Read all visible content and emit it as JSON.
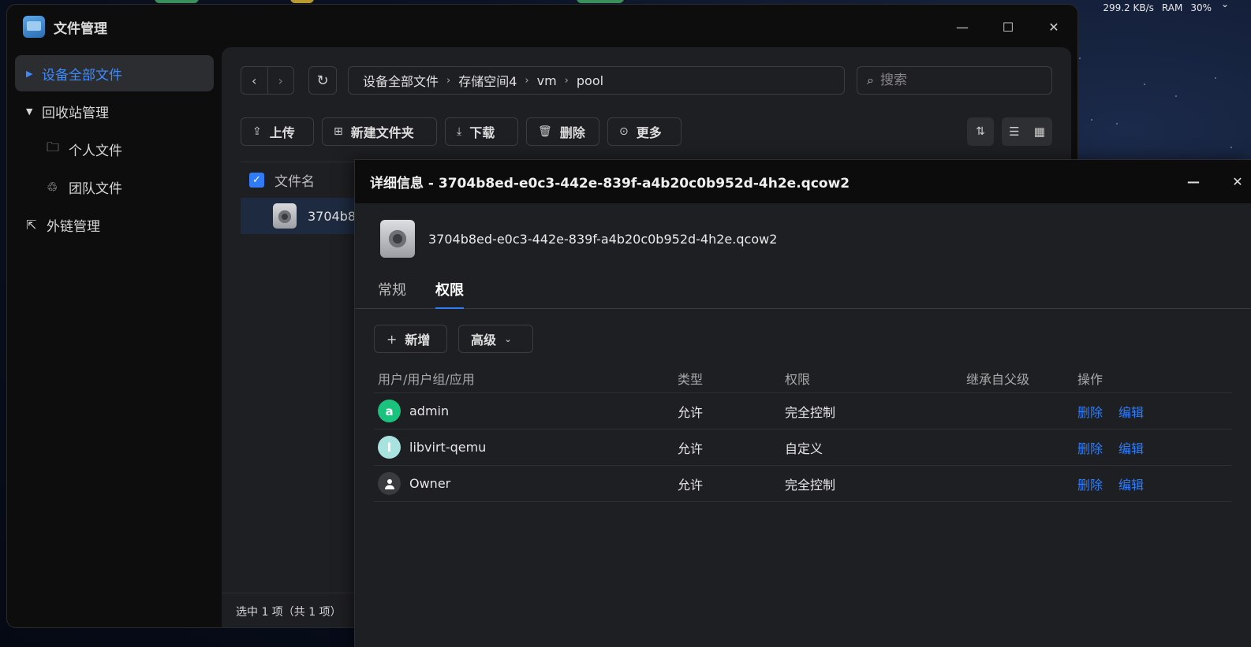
{
  "status_bar": {
    "net_speed": "299.2 KB/s",
    "ram_label": "RAM",
    "ram_value": "30%"
  },
  "app": {
    "title": "文件管理"
  },
  "sidebar": {
    "items": [
      {
        "label": "设备全部文件"
      },
      {
        "label": "回收站管理"
      },
      {
        "label": "个人文件"
      },
      {
        "label": "团队文件"
      },
      {
        "label": "外链管理"
      }
    ]
  },
  "breadcrumb": [
    "设备全部文件",
    "存储空间4",
    "vm",
    "pool"
  ],
  "search": {
    "placeholder": "搜索"
  },
  "toolbar": {
    "upload": "上传",
    "new_folder": "新建文件夹",
    "download": "下载",
    "delete": "删除",
    "more": "更多"
  },
  "file_list": {
    "header_name": "文件名",
    "rows": [
      {
        "name": "3704b8"
      }
    ]
  },
  "footer": {
    "selection": "选中 1 项（共 1 项）"
  },
  "details": {
    "title": "详细信息 - 3704b8ed-e0c3-442e-839f-a4b20c0b952d-4h2e.qcow2",
    "filename": "3704b8ed-e0c3-442e-839f-a4b20c0b952d-4h2e.qcow2",
    "tabs": [
      {
        "label": "常规"
      },
      {
        "label": "权限"
      }
    ],
    "add_button": "新增",
    "advanced_button": "高级",
    "columns": [
      "用户/用户组/应用",
      "类型",
      "权限",
      "继承自父级",
      "操作"
    ],
    "rows": [
      {
        "avatar": "a",
        "avatar_color": "#19c37d",
        "user": "admin",
        "type": "允许",
        "permission": "完全控制",
        "inherited": "",
        "delete": "删除",
        "edit": "编辑"
      },
      {
        "avatar": "l",
        "avatar_color": "#a9e3e0",
        "user": "libvirt-qemu",
        "type": "允许",
        "permission": "自定义",
        "inherited": "",
        "delete": "删除",
        "edit": "编辑"
      },
      {
        "avatar": "person-icon",
        "avatar_color": "#3a3b3f",
        "user": "Owner",
        "type": "允许",
        "permission": "完全控制",
        "inherited": "",
        "delete": "删除",
        "edit": "编辑"
      }
    ]
  },
  "colors": {
    "accent": "#2f7cf6",
    "selected_row": "#1d2a3f"
  }
}
